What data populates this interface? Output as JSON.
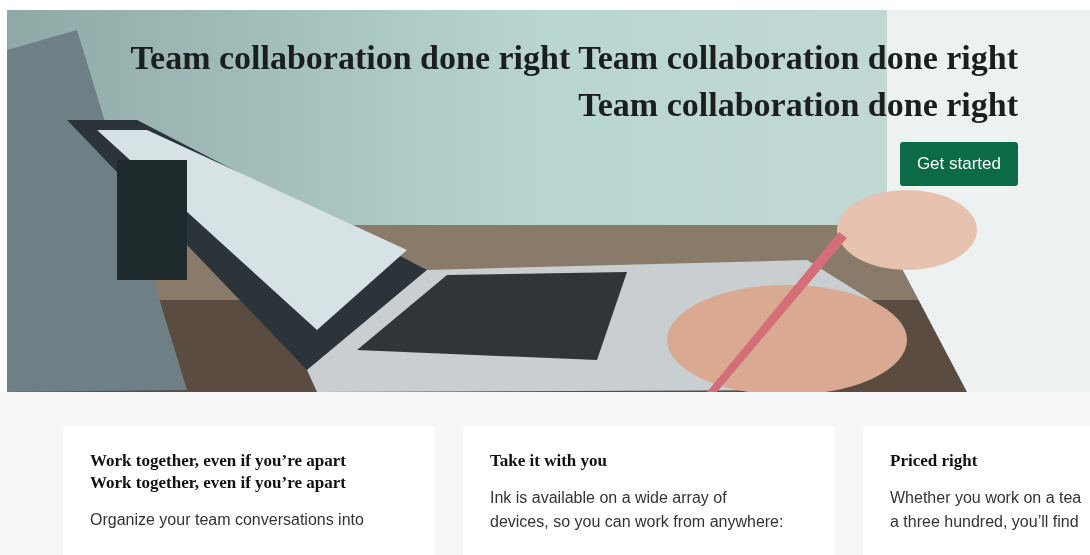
{
  "hero": {
    "kind": "picture",
    "title": "Team collaboration done right Team collaboration done right Team collaboration done right",
    "button": "Get started"
  },
  "features": [
    {
      "title": "Work together, even if you’re apart Work together, even if you’re apart",
      "body_lines": [
        "Organize your team conversations into"
      ]
    },
    {
      "title": "Take it with you",
      "body_lines": [
        "Ink is available on a wide array of",
        "devices, so you can work from anywhere:"
      ]
    },
    {
      "title": "Priced right",
      "body_lines": [
        "Whether you work on a tea",
        "a three hundred, you’ll find"
      ]
    }
  ]
}
